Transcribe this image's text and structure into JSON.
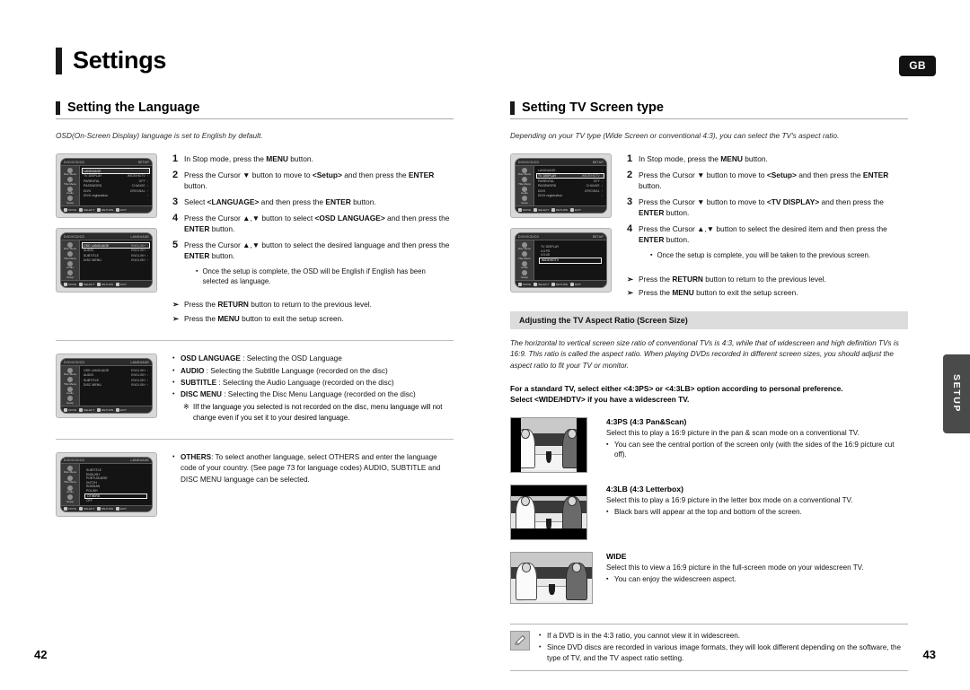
{
  "header": {
    "title": "Settings",
    "region_badge": "GB",
    "side_tab": "SETUP"
  },
  "page_numbers": {
    "left": "42",
    "right": "43"
  },
  "left_column": {
    "section_title": "Setting the Language",
    "lead": "OSD(On-Screen Display) language is set to English by default.",
    "steps": [
      {
        "num": "1",
        "html": "In Stop mode, press the <b>MENU</b> button."
      },
      {
        "num": "2",
        "html": "Press the Cursor ▼ button to move to <b>&lt;Setup&gt;</b> and then press the <b>ENTER</b> button."
      },
      {
        "num": "3",
        "html": "Select <b>&lt;LANGUAGE&gt;</b> and then press the <b>ENTER</b> button."
      },
      {
        "num": "4",
        "html": "Press the Cursor ▲,▼ button to select <b>&lt;OSD LANGUAGE&gt;</b> and then press the <b>ENTER</b> button."
      },
      {
        "num": "5",
        "html": "Press the Cursor ▲,▼ button to select the desired language and then press the <b>ENTER</b> button."
      }
    ],
    "step_note": "Once the setup is complete, the OSD will be English if English has been selected as language.",
    "arrows": [
      "Press the <b>RETURN</b> button to return to the previous level.",
      "Press the <b>MENU</b> button to exit the setup screen."
    ],
    "definitions": [
      {
        "term": "OSD LANGUAGE",
        "desc": ": Selecting the OSD Language"
      },
      {
        "term": "AUDIO",
        "desc": ": Selecting the Subtitle Language (recorded on the disc)"
      },
      {
        "term": "SUBTITLE",
        "desc": ": Selecting the Audio Language (recorded on the disc)"
      },
      {
        "term": "DISC MENU",
        "desc": ": Selecting the Disc Menu Language (recorded on the disc)"
      }
    ],
    "definition_note": "IIf the language you selected is not recorded on the disc, menu language will not change even if you set it to your desired language.",
    "others": {
      "term": "OTHERS",
      "desc": ": To select another language, select OTHERS and enter the language code of your country. (See page 73 for language codes) AUDIO, SUBTITLE and DISC MENU language can be selected."
    },
    "osd_shots": [
      {
        "header_left": "DVD/VCD/CD",
        "header_right": "SETUP",
        "sidebar": [
          "Disc Menu",
          "Title Menu",
          "Audio",
          "Setup"
        ],
        "rows": [
          {
            "label": "LANGUAGE",
            "value": "",
            "selected": true
          },
          {
            "label": "TV DISPLAY",
            "value": "WIDE/HDTV",
            "selected": false
          },
          {
            "label": "PARENTAL",
            "value": "OFF",
            "selected": false
          },
          {
            "label": "PASSWORD",
            "value": "CHANGE",
            "selected": false
          },
          {
            "label": "DIVX",
            "value": "ORIGINAL",
            "selected": false
          },
          {
            "label": "DIVX registration",
            "value": "",
            "selected": false
          }
        ],
        "footer": [
          "MOVE",
          "SELECT",
          "RETURN",
          "EXIT"
        ]
      },
      {
        "header_left": "DVD/VCD/CD",
        "header_right": "LANGUAGE",
        "sidebar": [
          "Disc Menu",
          "Title Menu",
          "Audio",
          "Setup"
        ],
        "rows": [
          {
            "label": "OSD LANGUAGE",
            "value": "ENGLISH",
            "selected": true
          },
          {
            "label": "AUDIO",
            "value": "ENGLISH",
            "selected": false
          },
          {
            "label": "SUBTITLE",
            "value": "ENGLISH",
            "selected": false
          },
          {
            "label": "DISC MENU",
            "value": "ENGLISH",
            "selected": false
          }
        ],
        "footer": [
          "MOVE",
          "SELECT",
          "RETURN",
          "EXIT"
        ]
      },
      {
        "header_left": "DVD/VCD/CD",
        "header_right": "LANGUAGE",
        "sidebar": [
          "Disc Menu",
          "Title Menu",
          "Audio",
          "Setup"
        ],
        "rows": [
          {
            "label": "OSD LANGUAGE",
            "value": "ENGLISH",
            "selected": false
          },
          {
            "label": "AUDIO",
            "value": "ENGLISH",
            "selected": false
          },
          {
            "label": "SUBTITLE",
            "value": "ENGLISH",
            "selected": false
          },
          {
            "label": "DISC MENU",
            "value": "ENGLISH",
            "selected": false
          }
        ],
        "footer": [
          "MOVE",
          "SELECT",
          "RETURN",
          "EXIT"
        ]
      },
      {
        "header_left": "DVD/VCD/CD",
        "header_right": "LANGUAGE",
        "sidebar": [
          "Disc Menu",
          "Title Menu",
          "Audio",
          "Setup"
        ],
        "list_label": "SUBTITLE",
        "list": [
          "ENGLISH",
          "PORTUGUESE",
          "DUTCH",
          "RUSSIAN",
          "POLISH",
          "OTHERS",
          "OFF"
        ],
        "list_selected": "OTHERS",
        "footer": [
          "MOVE",
          "SELECT",
          "RETURN",
          "EXIT"
        ]
      }
    ]
  },
  "right_column": {
    "section_title": "Setting TV Screen type",
    "lead": "Depending on your TV type (Wide Screen  or conventional 4:3), you can select the TV's aspect ratio.",
    "steps": [
      {
        "num": "1",
        "html": "In Stop mode, press the <b>MENU</b> button."
      },
      {
        "num": "2",
        "html": "Press the Cursor ▼ button to move to <b>&lt;Setup&gt;</b> and then press the <b>ENTER</b> button."
      },
      {
        "num": "3",
        "html": "Press the Cursor ▼ button to move to <b>&lt;TV DISPLAY&gt;</b> and then press the <b>ENTER</b> button."
      },
      {
        "num": "4",
        "html": "Press the Cursor ▲,▼ button to select the desired item and then press the <b>ENTER</b> button."
      }
    ],
    "step_note": "Once the setup is complete, you will be taken to the previous screen.",
    "arrows": [
      "Press the <b>RETURN</b> button to return to the previous level.",
      "Press the <b>MENU</b> button to exit the setup screen."
    ],
    "band_title": "Adjusting the TV Aspect Ratio (Screen Size)",
    "para_italic": "The horizontal to vertical screen size ratio of conventional TVs is 4:3, while that of widescreen and high definition TVs is 16:9. This ratio is called the aspect ratio. When playing DVDs recorded in different screen sizes, you should adjust the aspect ratio to fit your TV or monitor.",
    "para_bold": "For a standard TV, select either <4:3PS> or <4:3LB> option according to personal preference.\nSelect <WIDE/HDTV> if you have a widescreen TV.",
    "options": [
      {
        "mode": "pan_scan",
        "title": "4:3PS (4:3 Pan&Scan)",
        "desc": "Select this to play a 16:9 picture in the pan & scan mode on a conventional TV.",
        "bullet": "You can see the central portion of the screen only (with the sides of the 16:9 picture cut off)."
      },
      {
        "mode": "letterbox",
        "title": "4:3LB (4:3 Letterbox)",
        "desc": "Select this to play a 16:9 picture in the letter box mode on a conventional TV.",
        "bullet": "Black bars will appear at the top and bottom of the screen."
      },
      {
        "mode": "wide",
        "title": "WIDE",
        "desc": "Select this to view a 16:9 picture in the full-screen mode on your widescreen TV.",
        "bullet": "You can enjoy the widescreen aspect."
      }
    ],
    "notes": [
      "If a DVD is in the 4:3 ratio, you cannot view it in widescreen.",
      "Since DVD discs are recorded in various image formats, they will look different depending on the software, the type of TV, and the TV aspect ratio setting."
    ],
    "osd_shots": [
      {
        "header_left": "DVD/VCD/CD",
        "header_right": "SETUP",
        "sidebar": [
          "Disc Menu",
          "Title Menu",
          "Audio",
          "Setup"
        ],
        "rows": [
          {
            "label": "LANGUAGE",
            "value": "",
            "selected": false
          },
          {
            "label": "TV DISPLAY",
            "value": "WIDE/HDTV",
            "selected": true
          },
          {
            "label": "PARENTAL",
            "value": "OFF",
            "selected": false
          },
          {
            "label": "PASSWORD",
            "value": "CHANGE",
            "selected": false
          },
          {
            "label": "DIVX",
            "value": "ORIGINAL",
            "selected": false
          },
          {
            "label": "DIVX registration",
            "value": "",
            "selected": false
          }
        ],
        "footer": [
          "MOVE",
          "SELECT",
          "RETURN",
          "EXIT"
        ]
      },
      {
        "header_left": "DVD/VCD/CD",
        "header_right": "SETUP",
        "sidebar": [
          "Disc Menu",
          "Title Menu",
          "Audio",
          "Setup"
        ],
        "list_label": "TV DISPLAY",
        "list": [
          "4:3 PS",
          "4:3 LB",
          "WIDE/HDTV"
        ],
        "list_selected": "WIDE/HDTV",
        "footer": [
          "MOVE",
          "SELECT",
          "RETURN",
          "EXIT"
        ]
      }
    ]
  }
}
